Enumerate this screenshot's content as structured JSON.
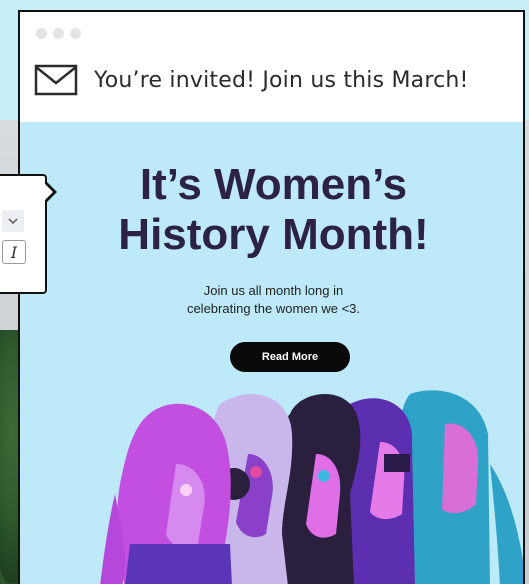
{
  "email": {
    "subject": "You’re invited! Join us this March!",
    "headline_line1": "It’s Women’s",
    "headline_line2": "History Month!",
    "body_line1": "Join us all month long in",
    "body_line2": "celebrating the women we <3.",
    "cta_label": "Read More"
  },
  "toolbar": {
    "italic_glyph": "I",
    "dropdown_icon": "chevron-down-icon"
  },
  "colors": {
    "hero_bg": "#bde9f8",
    "headline": "#2b2244",
    "cta_bg": "#0a0a0a"
  }
}
